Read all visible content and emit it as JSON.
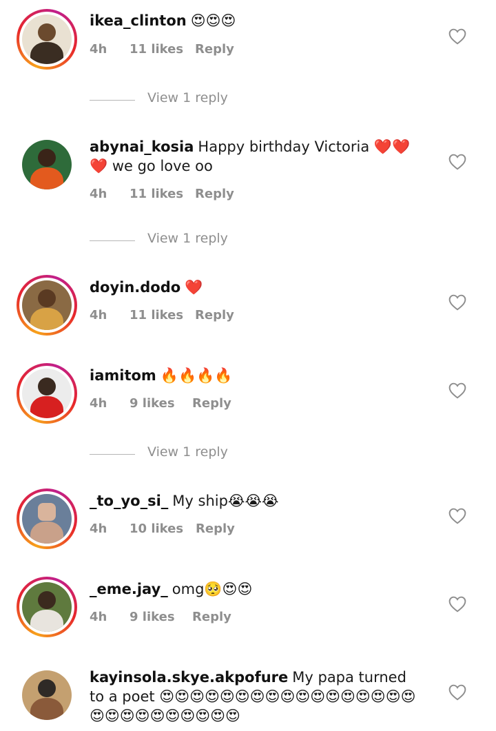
{
  "comments": [
    {
      "username": "ikea_clinton",
      "text": "😍😍😍",
      "time": "4h",
      "likes": "11 likes",
      "reply": "Reply",
      "view_replies": "View 1 reply",
      "avatar_colors": [
        "#6b4a2e",
        "#d9c6a4"
      ]
    },
    {
      "username": "abynai_kosia",
      "text": "Happy birthday Victoria ❤️❤️❤️ we go love oo",
      "time": "4h",
      "likes": "11 likes",
      "reply": "Reply",
      "view_replies": "View 1 reply",
      "avatar_colors": [
        "#3a2418",
        "#e35a1e"
      ]
    },
    {
      "username": "doyin.dodo",
      "text": "❤️",
      "time": "4h",
      "likes": "11 likes",
      "reply": "Reply",
      "avatar_colors": [
        "#5a3a22",
        "#d8a245"
      ]
    },
    {
      "username": "iamitom",
      "text": "🔥🔥🔥🔥",
      "time": "4h",
      "likes": "9 likes",
      "reply": "Reply",
      "view_replies": "View 1 reply",
      "avatar_colors": [
        "#3a2a20",
        "#d72020"
      ]
    },
    {
      "username": "_to_yo_si_",
      "text": "My ship😭😭😭",
      "time": "4h",
      "likes": "10 likes",
      "reply": "Reply",
      "avatar_colors": [
        "#d9b49c",
        "#6a7f9a"
      ]
    },
    {
      "username": "_eme.jay_",
      "text": "omg🥺😍😍",
      "time": "4h",
      "likes": "9 likes",
      "reply": "Reply",
      "avatar_colors": [
        "#3b2a1e",
        "#5f7a3e"
      ]
    },
    {
      "username": "kayinsola.skye.akpofure",
      "text": "My papa turned to a poet 😍😍😍😍😍😍😍😍😍😍😍😍😍😍😍😍😍😍😍😍😍😍😍😍😍😍😍",
      "time": "",
      "likes": "",
      "reply": "",
      "avatar_colors": [
        "#2f2a26",
        "#c4a070"
      ]
    }
  ]
}
